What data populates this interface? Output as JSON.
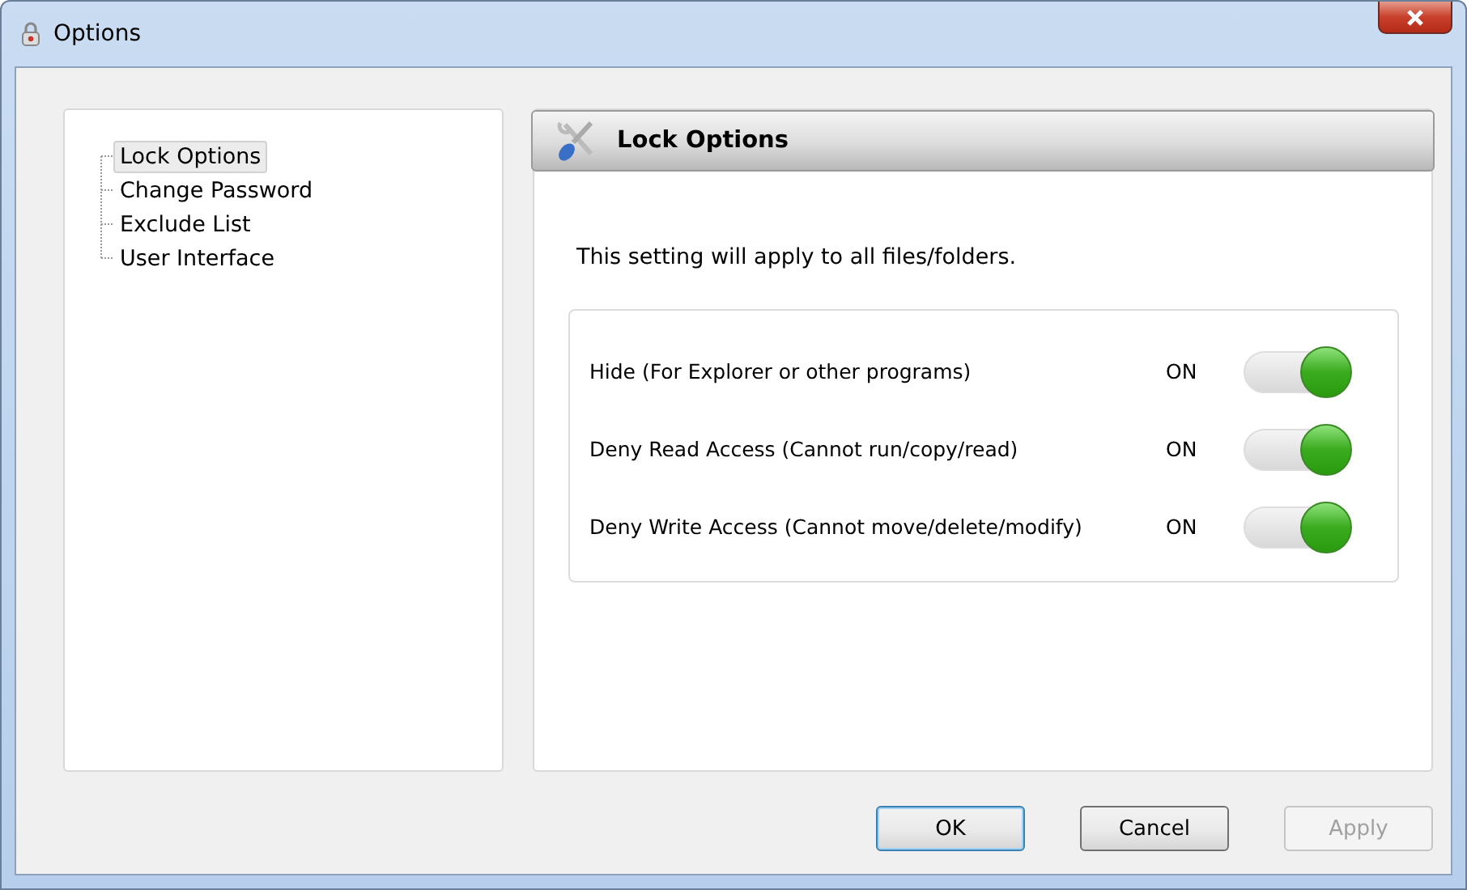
{
  "window": {
    "title": "Options"
  },
  "tree": {
    "items": [
      {
        "label": "Lock Options",
        "selected": true
      },
      {
        "label": "Change Password",
        "selected": false
      },
      {
        "label": "Exclude List",
        "selected": false
      },
      {
        "label": "User Interface",
        "selected": false
      }
    ]
  },
  "panel": {
    "title": "Lock Options",
    "description": "This setting will apply to all files/folders.",
    "settings": [
      {
        "label": "Hide (For Explorer or other programs)",
        "state_text": "ON",
        "on": true
      },
      {
        "label": "Deny Read Access (Cannot run/copy/read)",
        "state_text": "ON",
        "on": true
      },
      {
        "label": "Deny Write Access (Cannot move/delete/modify)",
        "state_text": "ON",
        "on": true
      }
    ]
  },
  "buttons": [
    {
      "label": "OK",
      "kind": "default",
      "disabled": false
    },
    {
      "label": "Cancel",
      "kind": "normal",
      "disabled": false
    },
    {
      "label": "Apply",
      "kind": "normal",
      "disabled": true
    }
  ]
}
